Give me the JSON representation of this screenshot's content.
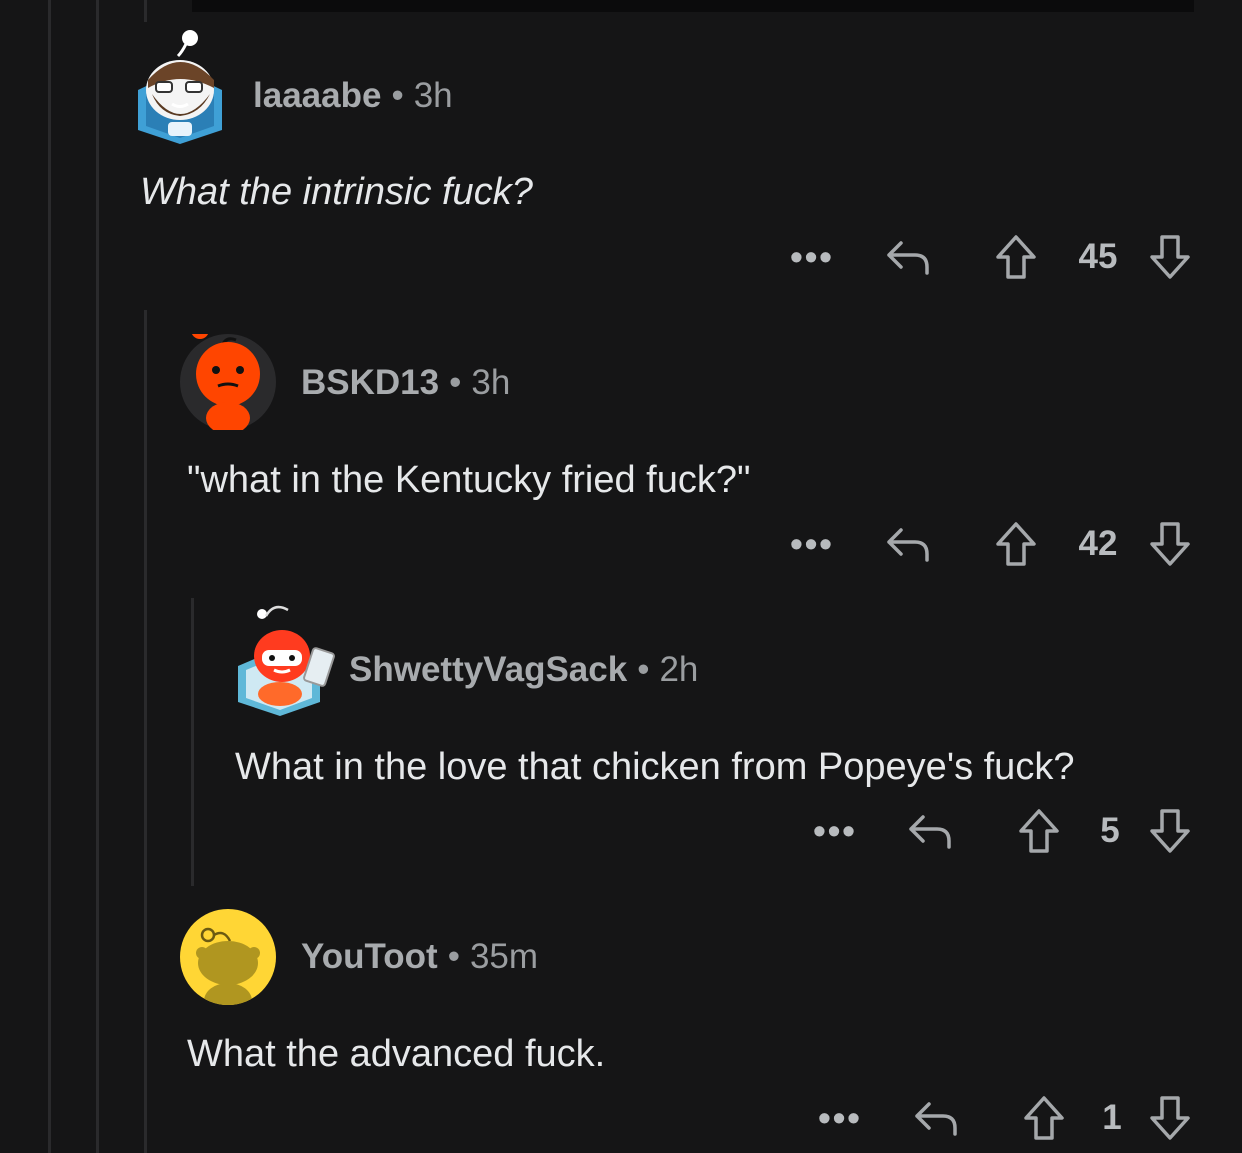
{
  "comments": [
    {
      "user": "laaaabe",
      "sep": "•",
      "time": "3h",
      "text": "What the intrinsic fuck?",
      "votes": "45",
      "more": "•••"
    },
    {
      "user": "BSKD13",
      "sep": "•",
      "time": "3h",
      "text": "\"what in the Kentucky fried fuck?\"",
      "votes": "42",
      "more": "•••"
    },
    {
      "user": "ShwettyVagSack",
      "sep": "•",
      "time": "2h",
      "text": "What in the love that chicken from Popeye's fuck?",
      "votes": "5",
      "more": "•••"
    },
    {
      "user": "YouToot",
      "sep": "•",
      "time": "35m",
      "text": "What the advanced fuck.",
      "votes": "1",
      "more": "•••"
    }
  ],
  "colors": {
    "background": "#151516",
    "thread_line": "#2a2a2c",
    "icon": "#a5a8ab",
    "snoo_orange": "#ff4500",
    "avatar_yellow": "#ffd635"
  },
  "icons": [
    "more-icon",
    "reply-icon",
    "upvote-icon",
    "downvote-icon"
  ]
}
